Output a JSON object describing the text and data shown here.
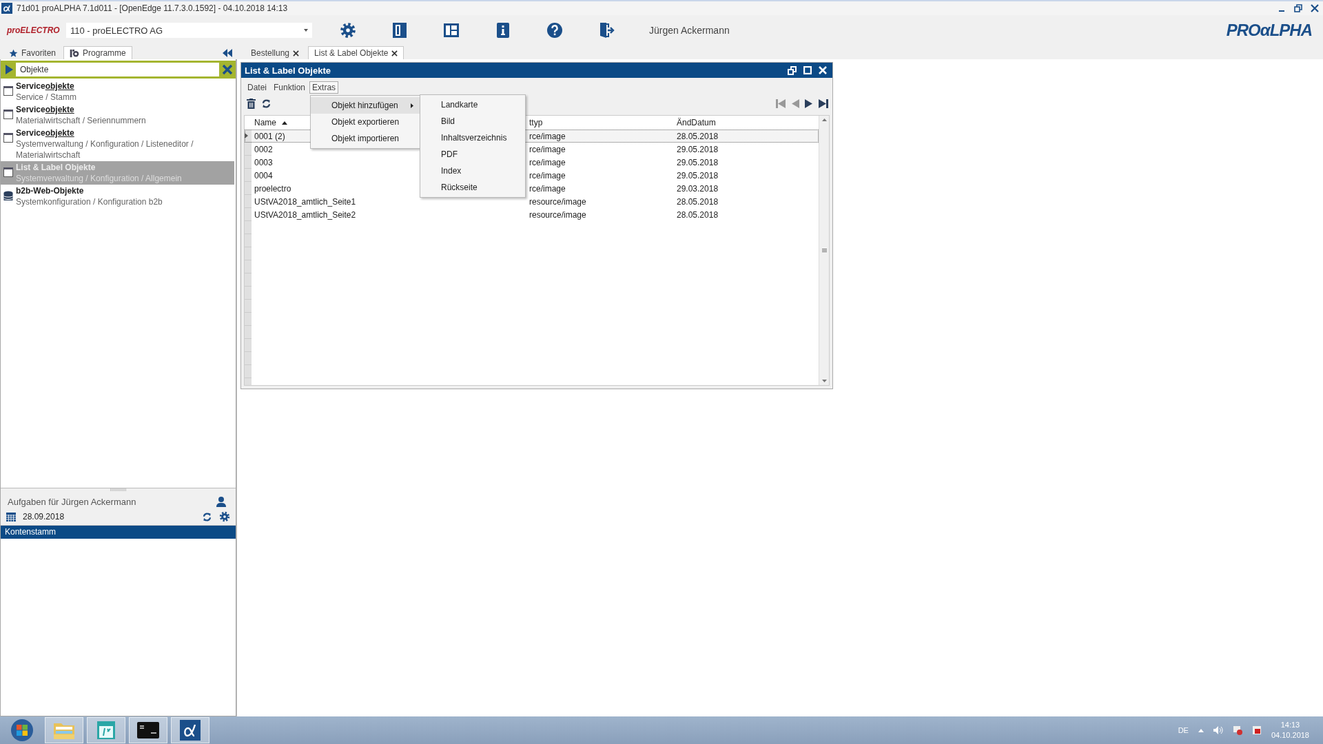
{
  "title_bar": {
    "title": "71d01 proALPHA 7.1d011 - [OpenEdge 11.7.3.0.1592] - 04.10.2018 14:13"
  },
  "header": {
    "company_logo": "proELECTRO",
    "company_select": "110 - proELECTRO AG",
    "user": "Jürgen Ackermann",
    "brand_logo": "PROαLPHA"
  },
  "side_tabs": [
    {
      "label": "Favoriten",
      "selected": false
    },
    {
      "label": "Programme",
      "selected": true
    }
  ],
  "doc_tabs": [
    {
      "label": "Bestellung",
      "selected": false
    },
    {
      "label": "List & Label Objekte",
      "selected": true
    }
  ],
  "search": {
    "value": "Objekte"
  },
  "results": [
    {
      "kind": "window",
      "title": "Service",
      "match": "objekte",
      "path": "Service / Stamm",
      "selected": false
    },
    {
      "kind": "window",
      "title": "Service",
      "match": "objekte",
      "path": "Materialwirtschaft / Seriennummern",
      "selected": false
    },
    {
      "kind": "window",
      "title": "Service",
      "match": "objekte",
      "path": "Systemverwaltung / Konfiguration / Listeneditor / Materialwirtschaft",
      "selected": false
    },
    {
      "kind": "window",
      "title": "List & Label Objekte",
      "path": "Systemverwaltung / Konfiguration / Allgemein",
      "selected": true
    },
    {
      "kind": "database",
      "title": "b2b-Web-Objekte",
      "path": "Systemkonfiguration / Konfiguration b2b",
      "selected": false
    }
  ],
  "tasks": {
    "title": "Aufgaben für Jürgen Ackermann",
    "date": "28.09.2018",
    "items": [
      {
        "label": "Kontenstamm",
        "selected": true
      }
    ]
  },
  "window": {
    "title": "List & Label Objekte",
    "menu": [
      {
        "label": "Datei",
        "open": false
      },
      {
        "label": "Funktion",
        "open": false
      },
      {
        "label": "Extras",
        "open": true
      }
    ],
    "dropdown": [
      {
        "label": "Objekt hinzufügen",
        "submenu": true,
        "selected": true
      },
      {
        "label": "Objekt exportieren",
        "submenu": false,
        "selected": false
      },
      {
        "label": "Objekt importieren",
        "submenu": false,
        "selected": false
      }
    ],
    "submenu": [
      "Landkarte",
      "Bild",
      "Inhaltsverzeichnis",
      "PDF",
      "Index",
      "Rückseite"
    ],
    "table": {
      "columns": [
        {
          "label": "Name",
          "sort_ascending": true
        },
        {
          "label": "ttyp"
        },
        {
          "label": "ÄndDatum"
        }
      ],
      "rows": [
        {
          "cells": [
            "0001 (2)",
            "rce/image",
            "28.05.2018"
          ],
          "selected": true
        },
        {
          "cells": [
            "0002",
            "rce/image",
            "29.05.2018"
          ],
          "selected": false
        },
        {
          "cells": [
            "0003",
            "rce/image",
            "29.05.2018"
          ],
          "selected": false
        },
        {
          "cells": [
            "0004",
            "rce/image",
            "29.05.2018"
          ],
          "selected": false
        },
        {
          "cells": [
            "proelectro",
            "rce/image",
            "29.03.2018"
          ],
          "selected": false
        },
        {
          "cells": [
            "UStVA2018_amtlich_Seite1",
            "resource/image",
            "28.05.2018"
          ],
          "selected": false
        },
        {
          "cells": [
            "UStVA2018_amtlich_Seite2",
            "resource/image",
            "28.05.2018"
          ],
          "selected": false
        }
      ]
    }
  },
  "taskbar": {
    "language": "DE",
    "time": "14:13",
    "date": "04.10.2018"
  }
}
